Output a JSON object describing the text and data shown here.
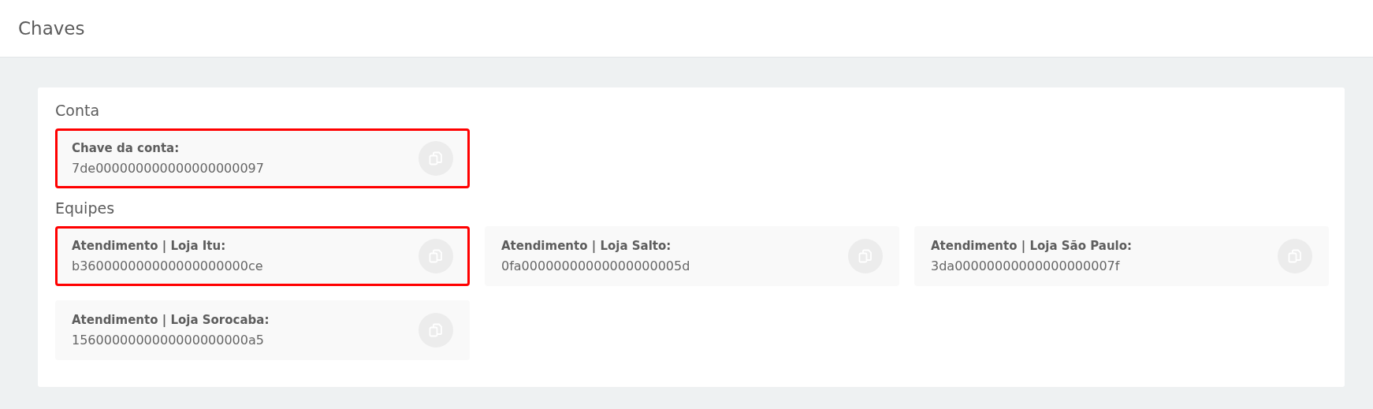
{
  "header": {
    "title": "Chaves"
  },
  "sections": [
    {
      "title": "Conta",
      "keys": [
        {
          "label": "Chave da conta:",
          "value": "7de000000000000000000097",
          "highlighted": true
        }
      ]
    },
    {
      "title": "Equipes",
      "keys": [
        {
          "label": "Atendimento | Loja Itu:",
          "value": "b360000000000000000000ce",
          "highlighted": true
        },
        {
          "label": "Atendimento | Loja Salto:",
          "value": "0fa00000000000000000005d",
          "highlighted": false
        },
        {
          "label": "Atendimento | Loja São Paulo:",
          "value": "3da00000000000000000007f",
          "highlighted": false
        },
        {
          "label": "Atendimento | Loja Sorocaba:",
          "value": "1560000000000000000000a5",
          "highlighted": false
        }
      ]
    }
  ]
}
